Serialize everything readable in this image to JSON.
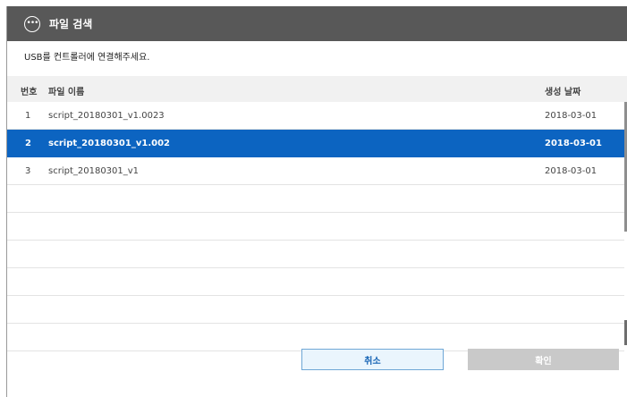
{
  "dialog": {
    "title": "파일 검색",
    "title_icon": "more-icon",
    "instruction": "USB를 컨트롤러에 연결해주세요."
  },
  "list": {
    "headers": {
      "number": "번호",
      "name": "파일 이름",
      "date": "생성 날짜"
    },
    "rows": [
      {
        "number": "1",
        "name": "script_20180301_v1.0023",
        "date": "2018-03-01",
        "selected": false
      },
      {
        "number": "2",
        "name": "script_20180301_v1.002",
        "date": "2018-03-01",
        "selected": true
      },
      {
        "number": "3",
        "name": "script_20180301_v1",
        "date": "2018-03-01",
        "selected": false
      }
    ]
  },
  "buttons": {
    "cancel": "취소",
    "confirm": "확인"
  },
  "colors": {
    "titlebar": "#585858",
    "selection": "#0c64c1",
    "cancel_border": "#6fa7d6",
    "confirm_disabled": "#c9c9c9"
  }
}
